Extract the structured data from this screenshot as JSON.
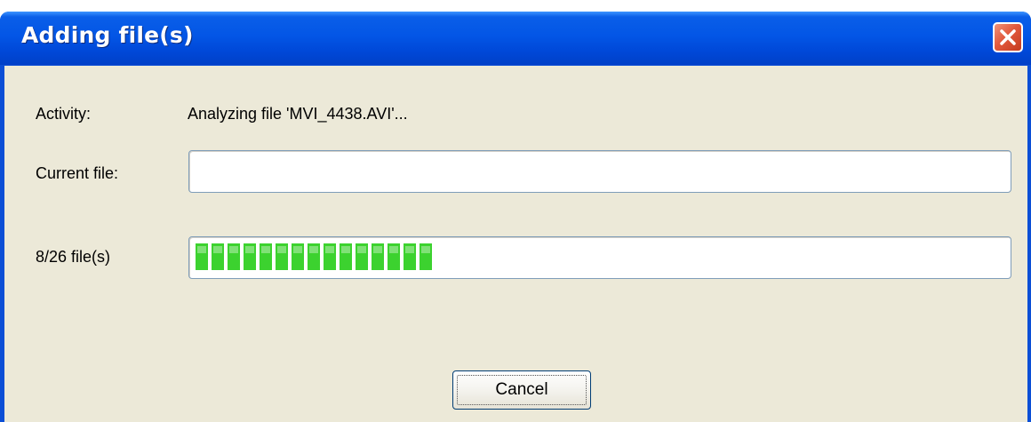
{
  "window": {
    "title": "Adding file(s)"
  },
  "activity": {
    "label": "Activity:",
    "value": "Analyzing file 'MVI_4438.AVI'..."
  },
  "current_file": {
    "label": "Current file:",
    "progress": 0
  },
  "overall": {
    "label": "8/26 file(s)",
    "completed": 8,
    "total": 26,
    "bar_color": "#3cd22f"
  },
  "buttons": {
    "cancel_label": "Cancel"
  },
  "colors": {
    "titlebar": "#0356e6",
    "dialog_bg": "#ece9d8",
    "close_button": "#e2593d"
  },
  "icons": {
    "close": "close-icon"
  }
}
